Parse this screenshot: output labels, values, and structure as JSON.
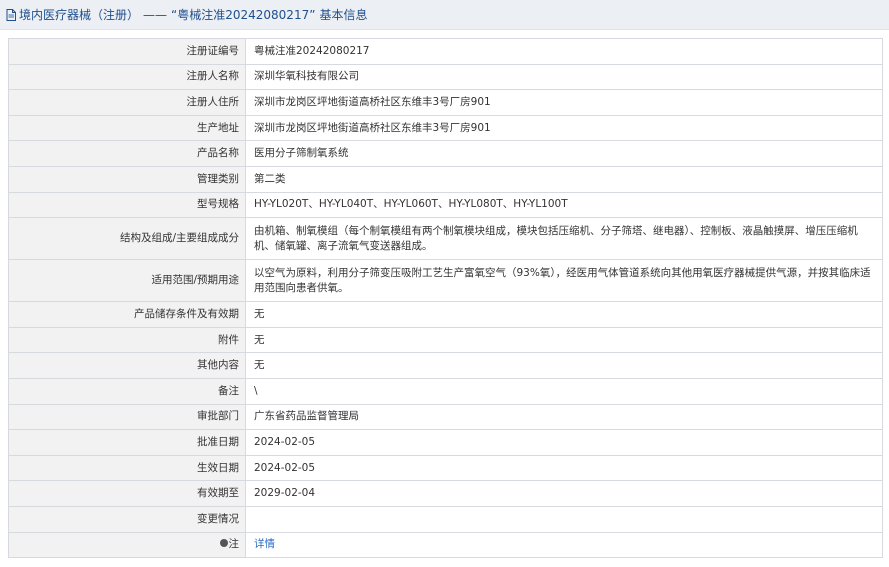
{
  "header": {
    "category": "境内医疗器械（注册）",
    "separator": "——",
    "reg_title": "“粤械注准20242080217”",
    "suffix": "基本信息",
    "icon": "document-icon"
  },
  "rows": [
    {
      "label": "注册证编号",
      "value": "粤械注准20242080217"
    },
    {
      "label": "注册人名称",
      "value": "深圳华氧科技有限公司"
    },
    {
      "label": "注册人住所",
      "value": "深圳市龙岗区坪地街道高桥社区东维丰3号厂房901"
    },
    {
      "label": "生产地址",
      "value": "深圳市龙岗区坪地街道高桥社区东维丰3号厂房901"
    },
    {
      "label": "产品名称",
      "value": "医用分子筛制氧系统"
    },
    {
      "label": "管理类别",
      "value": "第二类"
    },
    {
      "label": "型号规格",
      "value": "HY-YL020T、HY-YL040T、HY-YL060T、HY-YL080T、HY-YL100T"
    },
    {
      "label": "结构及组成/主要组成成分",
      "value": "由机箱、制氧模组（每个制氧模组有两个制氧模块组成，模块包括压缩机、分子筛塔、继电器）、控制板、液晶触摸屏、增压压缩机机、储氧罐、离子流氧气变送器组成。"
    },
    {
      "label": "适用范围/预期用途",
      "value": "以空气为原料，利用分子筛变压吸附工艺生产富氧空气（93%氧），经医用气体管道系统向其他用氧医疗器械提供气源，并按其临床适用范围向患者供氧。"
    },
    {
      "label": "产品储存条件及有效期",
      "value": "无"
    },
    {
      "label": "附件",
      "value": "无"
    },
    {
      "label": "其他内容",
      "value": "无"
    },
    {
      "label": "备注",
      "value": "\\"
    },
    {
      "label": "审批部门",
      "value": "广东省药品监督管理局"
    },
    {
      "label": "批准日期",
      "value": "2024-02-05"
    },
    {
      "label": "生效日期",
      "value": "2024-02-05"
    },
    {
      "label": "有效期至",
      "value": "2029-02-04"
    },
    {
      "label": "变更情况",
      "value": ""
    }
  ],
  "note_row": {
    "label": "注",
    "icon": "pin-icon",
    "link_text": "详情"
  },
  "colors": {
    "header_bg": "#eceff3",
    "header_text": "#1f4f8f",
    "label_bg": "#f2f2f2",
    "border": "#d6d9de",
    "link": "#2a6cc2"
  }
}
